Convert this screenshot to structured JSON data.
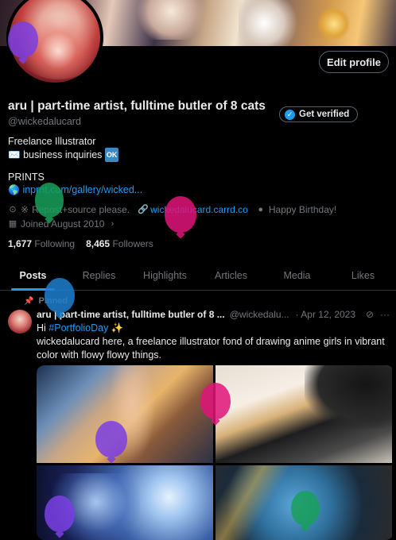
{
  "profile": {
    "display_name": "aru | part-time artist, fulltime butler of 8 cats",
    "handle": "@wickedalucard",
    "edit_profile_label": "Edit profile",
    "get_verified_label": "Get verified",
    "bio_line1": "Freelance Illustrator",
    "bio_line2_emoji": "✉️",
    "bio_line2_text": "business inquiries",
    "bio_line2_badge": "OK",
    "prints_label": "PRINTS",
    "prints_globe": "🌎",
    "prints_link": "inprnt.com/gallery/wicked...",
    "location_marker": "※",
    "location": "Repost+source please.",
    "website": "wickedalucard.carrd.co",
    "birthday": "Happy Birthday!",
    "joined": "Joined August 2010",
    "following_count": "1,677",
    "following_label": "Following",
    "followers_count": "8,465",
    "followers_label": "Followers"
  },
  "tabs": [
    {
      "label": "Posts",
      "active": true
    },
    {
      "label": "Replies",
      "active": false
    },
    {
      "label": "Highlights",
      "active": false
    },
    {
      "label": "Articles",
      "active": false
    },
    {
      "label": "Media",
      "active": false
    },
    {
      "label": "Likes",
      "active": false
    }
  ],
  "tweet": {
    "pinned_label": "Pinned",
    "name": "aru | part-time artist, fulltime butler of 8 ...",
    "handle": "@wickedalu...",
    "date": "· Apr 12, 2023",
    "more": "···",
    "text_hi": "Hi",
    "hashtag": "#PortfolioDay",
    "sparkle": "✨",
    "text_body": "wickedalucard here, a freelance illustrator fond of drawing anime girls in vibrant color with flowy flowy things."
  },
  "colors": {
    "accent": "#1d9bf0",
    "background": "#000000",
    "text_primary": "#e7e9ea",
    "text_secondary": "#71767b",
    "border": "#2f3336"
  },
  "icons": [
    "pin-icon",
    "location-icon",
    "link-icon",
    "balloon-icon",
    "calendar-icon",
    "chevron-right-icon",
    "verified-check-icon",
    "grok-icon",
    "more-icon"
  ]
}
